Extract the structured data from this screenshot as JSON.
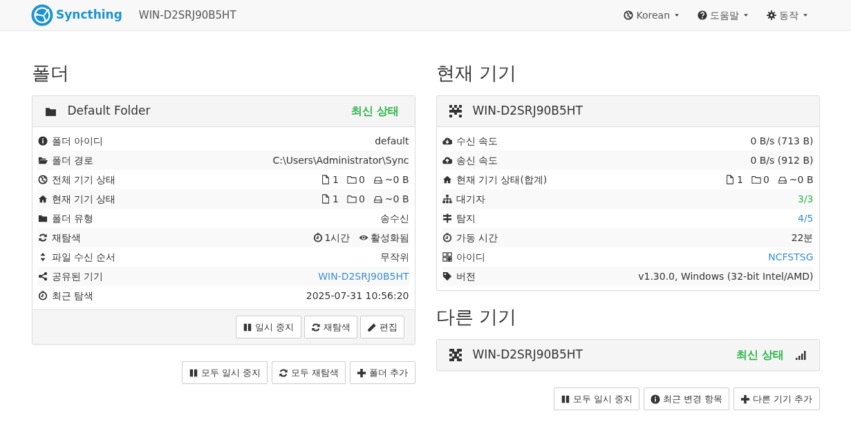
{
  "navbar": {
    "brand": "Syncthing",
    "hostname": "WIN-D2SRJ90B5HT",
    "menus": [
      {
        "label": "Korean"
      },
      {
        "label": "도움말"
      },
      {
        "label": "동작"
      }
    ]
  },
  "folders": {
    "heading": "폴더",
    "items": [
      {
        "name": "Default Folder",
        "status": "최신 상태",
        "rows": [
          {
            "label": "폴더 아이디",
            "kind": "text",
            "value": "default"
          },
          {
            "label": "폴더 경로",
            "kind": "text",
            "value": "C:\\Users\\Administrator\\Sync"
          },
          {
            "label": "전체 기기 상태",
            "kind": "counts",
            "files": "1",
            "dirs": "0",
            "size": "~0 B"
          },
          {
            "label": "현재 기기 상태",
            "kind": "counts",
            "files": "1",
            "dirs": "0",
            "size": "~0 B"
          },
          {
            "label": "폴더 유형",
            "kind": "text",
            "value": "송수신"
          },
          {
            "label": "재탐색",
            "kind": "rescan",
            "interval": "1시간",
            "watcher": "활성화됨"
          },
          {
            "label": "파일 수신 순서",
            "kind": "text",
            "value": "무작위"
          },
          {
            "label": "공유된 기기",
            "kind": "link",
            "value": "WIN-D2SRJ90B5HT"
          },
          {
            "label": "최근 탐색",
            "kind": "text",
            "value": "2025-07-31 10:56:20"
          }
        ],
        "buttons": [
          "일시 중지",
          "재탐색",
          "편집"
        ]
      }
    ],
    "buttons": [
      "모두 일시 중지",
      "모두 재탐색",
      "폴더 추가"
    ]
  },
  "this_device": {
    "heading": "현재 기기",
    "name": "WIN-D2SRJ90B5HT",
    "rows": [
      {
        "label": "수신 속도",
        "kind": "text",
        "value": "0 B/s (713 B)"
      },
      {
        "label": "송신 속도",
        "kind": "text",
        "value": "0 B/s (912 B)"
      },
      {
        "label": "현재 기기 상태(합계)",
        "kind": "counts",
        "files": "1",
        "dirs": "0",
        "size": "~0 B"
      },
      {
        "label": "대기자",
        "kind": "good",
        "value": "3/3"
      },
      {
        "label": "탐지",
        "kind": "link",
        "value": "4/5"
      },
      {
        "label": "가동 시간",
        "kind": "text",
        "value": "22분"
      },
      {
        "label": "아이디",
        "kind": "link",
        "value": "NCFSTSG"
      },
      {
        "label": "버전",
        "kind": "text",
        "value": "v1.30.0, Windows (32-bit Intel/AMD)"
      }
    ]
  },
  "other_devices": {
    "heading": "다른 기기",
    "items": [
      {
        "name": "WIN-D2SRJ90B5HT",
        "status": "최신 상태"
      }
    ],
    "buttons": [
      "모두 일시 중지",
      "최근 변경 항목",
      "다른 기기 추가"
    ]
  }
}
